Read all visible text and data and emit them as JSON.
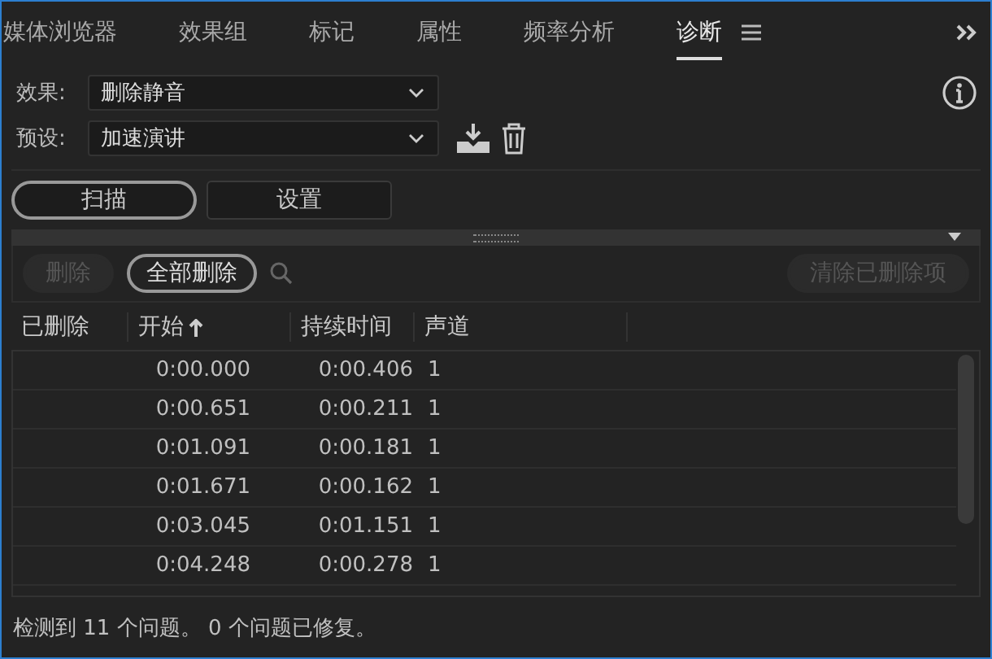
{
  "tabs": [
    {
      "label": "媒体浏览器",
      "selected": false
    },
    {
      "label": "效果组",
      "selected": false
    },
    {
      "label": "标记",
      "selected": false
    },
    {
      "label": "属性",
      "selected": false
    },
    {
      "label": "频率分析",
      "selected": false
    },
    {
      "label": "诊断",
      "selected": true
    }
  ],
  "effect": {
    "label": "效果:",
    "value": "删除静音"
  },
  "preset": {
    "label": "预设:",
    "value": "加速演讲"
  },
  "mode_buttons": [
    {
      "label": "扫描",
      "selected": true
    },
    {
      "label": "设置",
      "selected": false
    }
  ],
  "actions": [
    {
      "label": "删除",
      "disabled": true
    },
    {
      "label": "全部删除",
      "disabled": false
    }
  ],
  "clear_button": {
    "label": "清除已删除项",
    "disabled": true
  },
  "table": {
    "columns": [
      {
        "label": "已删除",
        "sorted": false
      },
      {
        "label": "开始",
        "sorted": true
      },
      {
        "label": "持续时间",
        "sorted": false
      },
      {
        "label": "声道",
        "sorted": false
      }
    ],
    "rows": [
      [
        "",
        "0:00.000",
        "0:00.406",
        "1"
      ],
      [
        "",
        "0:00.651",
        "0:00.211",
        "1"
      ],
      [
        "",
        "0:01.091",
        "0:00.181",
        "1"
      ],
      [
        "",
        "0:01.671",
        "0:00.162",
        "1"
      ],
      [
        "",
        "0:03.045",
        "0:01.151",
        "1"
      ],
      [
        "",
        "0:04.248",
        "0:00.278",
        "1"
      ]
    ]
  },
  "status_bar": "检测到 11 个问题。 0 个问题已修复。"
}
